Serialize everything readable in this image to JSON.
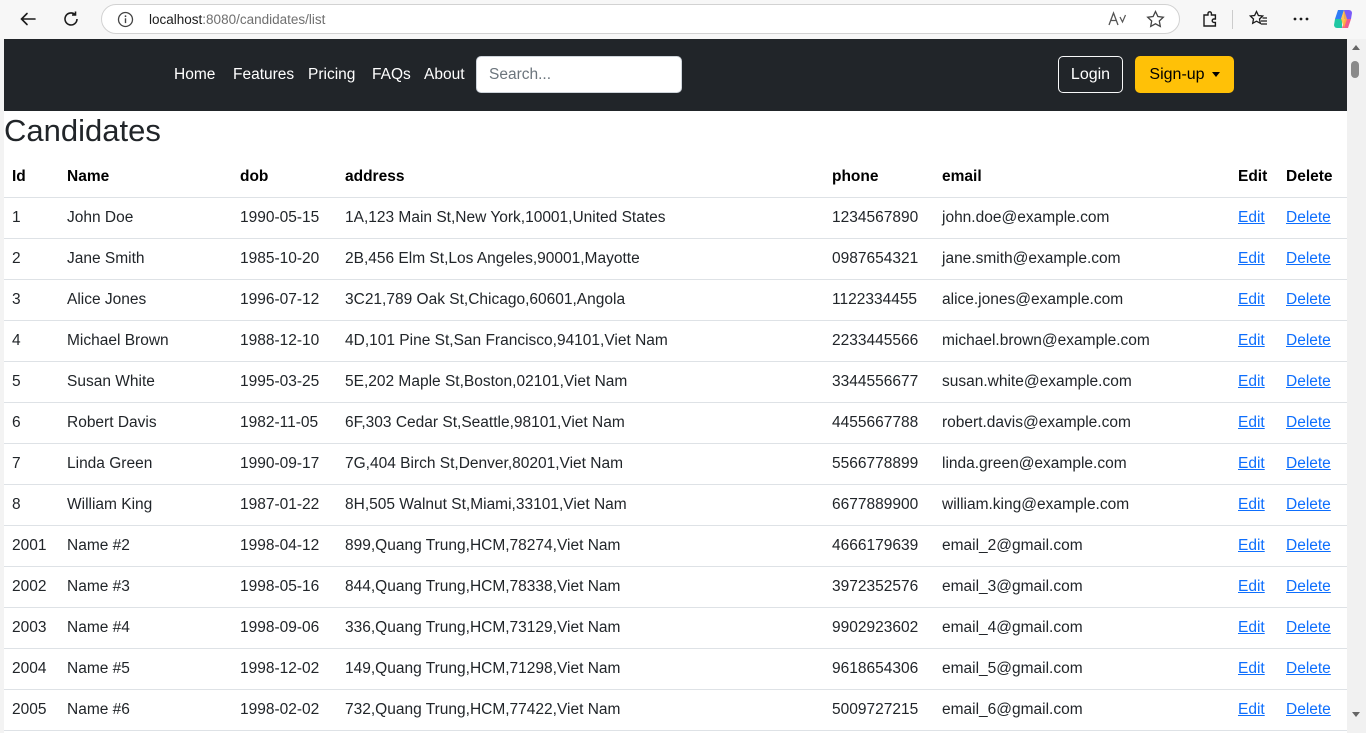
{
  "browser": {
    "url_host": "localhost",
    "url_rest": ":8080/candidates/list"
  },
  "navbar": {
    "links": [
      "Home",
      "Features",
      "Pricing",
      "FAQs",
      "About"
    ],
    "search_placeholder": "Search...",
    "login_label": "Login",
    "signup_label": "Sign-up"
  },
  "page_title": "Candidates",
  "table": {
    "headers": [
      "Id",
      "Name",
      "dob",
      "address",
      "phone",
      "email",
      "Edit",
      "Delete"
    ],
    "rows": [
      {
        "id": "1",
        "name": "John Doe",
        "dob": "1990-05-15",
        "address": "1A,123 Main St,New York,10001,United States",
        "phone": "1234567890",
        "email": "john.doe@example.com",
        "edit": "Edit",
        "delete": "Delete"
      },
      {
        "id": "2",
        "name": "Jane Smith",
        "dob": "1985-10-20",
        "address": "2B,456 Elm St,Los Angeles,90001,Mayotte",
        "phone": "0987654321",
        "email": "jane.smith@example.com",
        "edit": "Edit",
        "delete": "Delete"
      },
      {
        "id": "3",
        "name": "Alice Jones",
        "dob": "1996-07-12",
        "address": "3C21,789 Oak St,Chicago,60601,Angola",
        "phone": "1122334455",
        "email": "alice.jones@example.com",
        "edit": "Edit",
        "delete": "Delete"
      },
      {
        "id": "4",
        "name": "Michael Brown",
        "dob": "1988-12-10",
        "address": "4D,101 Pine St,San Francisco,94101,Viet Nam",
        "phone": "2233445566",
        "email": "michael.brown@example.com",
        "edit": "Edit",
        "delete": "Delete"
      },
      {
        "id": "5",
        "name": "Susan White",
        "dob": "1995-03-25",
        "address": "5E,202 Maple St,Boston,02101,Viet Nam",
        "phone": "3344556677",
        "email": "susan.white@example.com",
        "edit": "Edit",
        "delete": "Delete"
      },
      {
        "id": "6",
        "name": "Robert Davis",
        "dob": "1982-11-05",
        "address": "6F,303 Cedar St,Seattle,98101,Viet Nam",
        "phone": "4455667788",
        "email": "robert.davis@example.com",
        "edit": "Edit",
        "delete": "Delete"
      },
      {
        "id": "7",
        "name": "Linda Green",
        "dob": "1990-09-17",
        "address": "7G,404 Birch St,Denver,80201,Viet Nam",
        "phone": "5566778899",
        "email": "linda.green@example.com",
        "edit": "Edit",
        "delete": "Delete"
      },
      {
        "id": "8",
        "name": "William King",
        "dob": "1987-01-22",
        "address": "8H,505 Walnut St,Miami,33101,Viet Nam",
        "phone": "6677889900",
        "email": "william.king@example.com",
        "edit": "Edit",
        "delete": "Delete"
      },
      {
        "id": "2001",
        "name": "Name #2",
        "dob": "1998-04-12",
        "address": "899,Quang Trung,HCM,78274,Viet Nam",
        "phone": "4666179639",
        "email": "email_2@gmail.com",
        "edit": "Edit",
        "delete": "Delete"
      },
      {
        "id": "2002",
        "name": "Name #3",
        "dob": "1998-05-16",
        "address": "844,Quang Trung,HCM,78338,Viet Nam",
        "phone": "3972352576",
        "email": "email_3@gmail.com",
        "edit": "Edit",
        "delete": "Delete"
      },
      {
        "id": "2003",
        "name": "Name #4",
        "dob": "1998-09-06",
        "address": "336,Quang Trung,HCM,73129,Viet Nam",
        "phone": "9902923602",
        "email": "email_4@gmail.com",
        "edit": "Edit",
        "delete": "Delete"
      },
      {
        "id": "2004",
        "name": "Name #5",
        "dob": "1998-12-02",
        "address": "149,Quang Trung,HCM,71298,Viet Nam",
        "phone": "9618654306",
        "email": "email_5@gmail.com",
        "edit": "Edit",
        "delete": "Delete"
      },
      {
        "id": "2005",
        "name": "Name #6",
        "dob": "1998-02-02",
        "address": "732,Quang Trung,HCM,77422,Viet Nam",
        "phone": "5009727215",
        "email": "email_6@gmail.com",
        "edit": "Edit",
        "delete": "Delete"
      }
    ]
  },
  "colors": {
    "navbar_bg": "#212529",
    "signup_bg": "#ffc107",
    "link": "#0d6efd"
  },
  "icons": [
    "back-arrow-icon",
    "refresh-icon",
    "site-info-icon",
    "read-aloud-icon",
    "favorite-star-icon",
    "extensions-icon",
    "favorites-icon",
    "more-icon",
    "copilot-icon",
    "caret-down-icon"
  ]
}
